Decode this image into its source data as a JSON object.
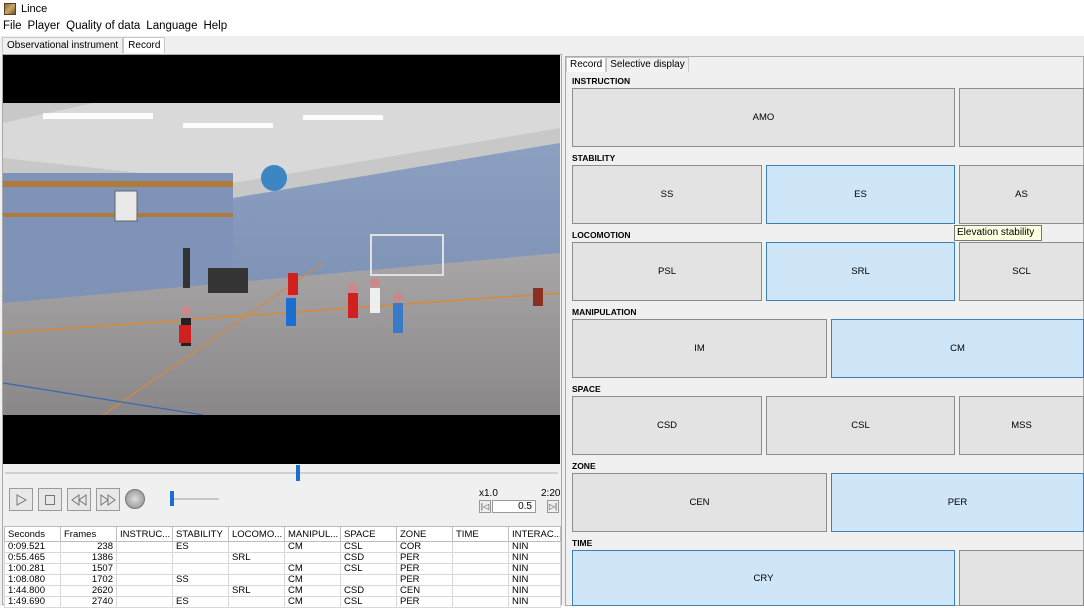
{
  "app": {
    "title": "Lince"
  },
  "menu": [
    "File",
    "Player",
    "Quality of data",
    "Language",
    "Help"
  ],
  "tabs": [
    "Observational instrument",
    "Record"
  ],
  "right_tabs": [
    "Record",
    "Selective display"
  ],
  "player": {
    "rate_label": "x1.0",
    "duration": "2:20",
    "rate_value": "0.5",
    "seek_position": 0.53,
    "volume_level": 0.04
  },
  "controls": [
    "play",
    "stop",
    "rewind",
    "fast-forward",
    "volume"
  ],
  "table": {
    "columns": [
      "Seconds",
      "Frames",
      "INSTRUC...",
      "STABILITY",
      "LOCOMO...",
      "MANIPUL...",
      "SPACE",
      "ZONE",
      "TIME",
      "INTERAC..."
    ],
    "rows": [
      [
        "0:09.521",
        "238",
        "",
        "ES",
        "",
        "CM",
        "CSL",
        "COR",
        "",
        "NIN"
      ],
      [
        "0:55.465",
        "1386",
        "",
        "",
        "SRL",
        "",
        "CSD",
        "PER",
        "",
        "NIN"
      ],
      [
        "1:00.281",
        "1507",
        "",
        "",
        "",
        "CM",
        "CSL",
        "PER",
        "",
        "NIN"
      ],
      [
        "1:08.080",
        "1702",
        "",
        "SS",
        "",
        "CM",
        "",
        "PER",
        "",
        "NIN"
      ],
      [
        "1:44.800",
        "2620",
        "",
        "",
        "SRL",
        "CM",
        "CSD",
        "CEN",
        "",
        "NIN"
      ],
      [
        "1:49.690",
        "2740",
        "",
        "ES",
        "",
        "CM",
        "CSL",
        "PER",
        "",
        "NIN"
      ]
    ]
  },
  "criteria": [
    {
      "label": "INSTRUCTION",
      "buttons": [
        {
          "label": "AMO",
          "selected": false
        },
        {
          "label": "",
          "selected": false
        }
      ]
    },
    {
      "label": "STABILITY",
      "buttons": [
        {
          "label": "SS",
          "selected": false
        },
        {
          "label": "ES",
          "selected": true
        },
        {
          "label": "AS",
          "selected": false
        }
      ]
    },
    {
      "label": "LOCOMOTION",
      "buttons": [
        {
          "label": "PSL",
          "selected": false
        },
        {
          "label": "SRL",
          "selected": true
        },
        {
          "label": "SCL",
          "selected": false
        }
      ]
    },
    {
      "label": "MANIPULATION",
      "buttons": [
        {
          "label": "IM",
          "selected": false
        },
        {
          "label": "CM",
          "selected": true
        }
      ]
    },
    {
      "label": "SPACE",
      "buttons": [
        {
          "label": "CSD",
          "selected": false
        },
        {
          "label": "CSL",
          "selected": false
        },
        {
          "label": "MSS",
          "selected": false
        }
      ]
    },
    {
      "label": "ZONE",
      "buttons": [
        {
          "label": "CEN",
          "selected": false
        },
        {
          "label": "PER",
          "selected": true
        }
      ]
    },
    {
      "label": "TIME",
      "buttons": [
        {
          "label": "CRY",
          "selected": true
        },
        {
          "label": "",
          "selected": false
        }
      ]
    }
  ],
  "tooltip": "Elevation stability",
  "colors": {
    "selected": "#cfe5f8",
    "unselected": "#e3e3e3",
    "accent": "#1a6fd1"
  }
}
